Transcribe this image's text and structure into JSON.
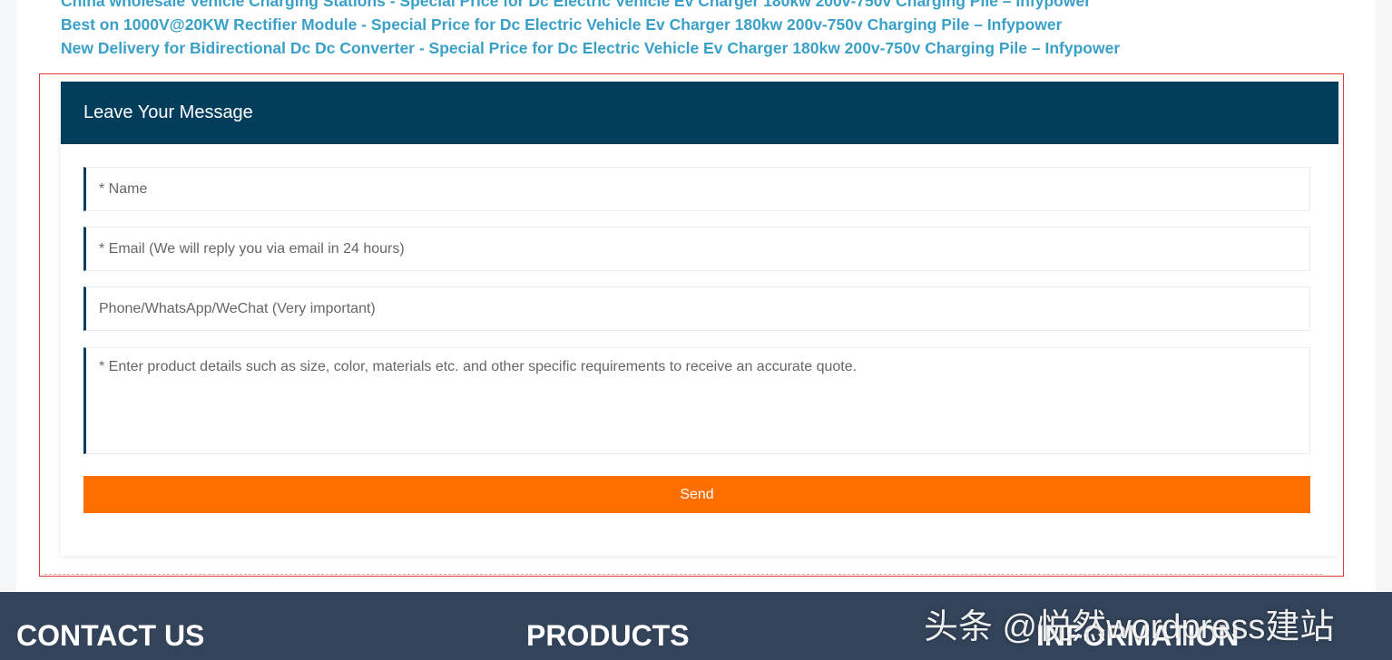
{
  "related_links": [
    "China wholesale Vehicle Charging Stations - Special Price for Dc Electric Vehicle Ev Charger 180kw 200v-750v Charging Pile – Infypower",
    "Best on 1000V@20KW Rectifier Module - Special Price for Dc Electric Vehicle Ev Charger 180kw 200v-750v Charging Pile – Infypower",
    "New Delivery for Bidirectional Dc Dc Converter - Special Price for Dc Electric Vehicle Ev Charger 180kw 200v-750v Charging Pile – Infypower"
  ],
  "form": {
    "title": "Leave Your Message",
    "name_placeholder": "* Name",
    "email_placeholder": "* Email (We will reply you via email in 24 hours)",
    "phone_placeholder": "Phone/WhatsApp/WeChat (Very important)",
    "message_placeholder": "* Enter product details such as size, color, materials etc. and other specific requirements to receive an accurate quote.",
    "send_label": "Send"
  },
  "footer": {
    "contact_heading": "CONTACT US",
    "products_heading": "PRODUCTS",
    "information_heading": "INFORMATION"
  },
  "watermark": "头条 @悦然wordpress建站",
  "colors": {
    "link": "#3aa0c8",
    "header_bg": "#023e5b",
    "send_button": "#ff6f00",
    "footer_bg": "#33445a"
  }
}
